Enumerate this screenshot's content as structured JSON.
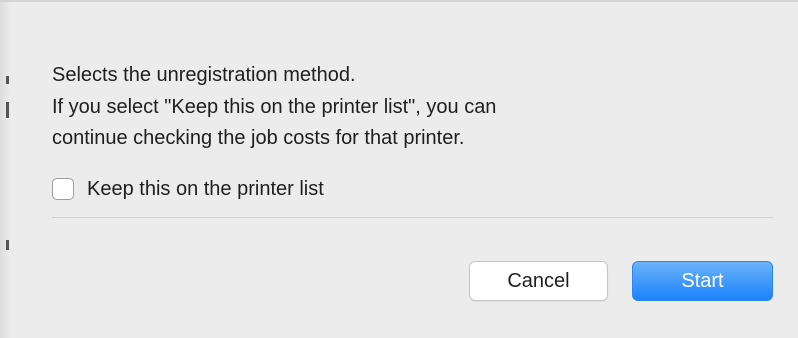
{
  "dialog": {
    "message_lines": [
      "Selects the unregistration method.",
      "If you select \"Keep this on the printer list\", you can",
      "continue checking the job costs for that printer."
    ],
    "checkbox": {
      "label": "Keep this on the printer list",
      "checked": false
    },
    "buttons": {
      "cancel_label": "Cancel",
      "start_label": "Start"
    }
  },
  "colors": {
    "background": "#ececec",
    "primary_button": "#1a82fb",
    "text": "#1e1e1e"
  }
}
